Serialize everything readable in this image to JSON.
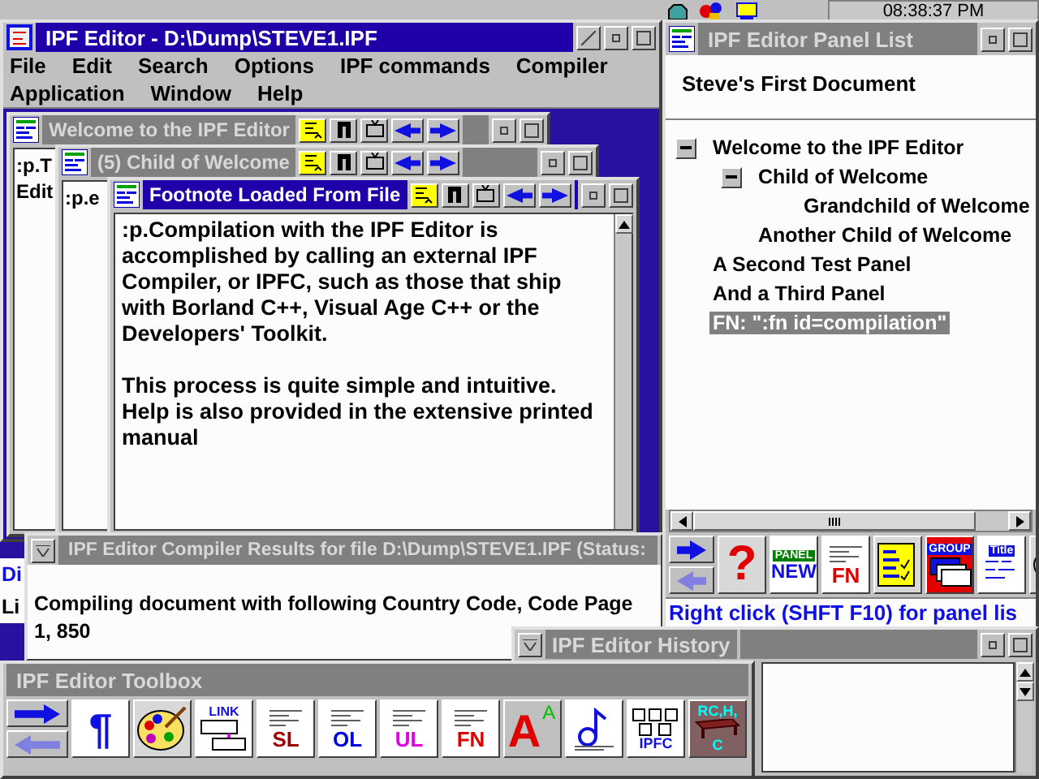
{
  "taskbar": {
    "clock": "08:38:37 PM"
  },
  "main_window": {
    "title": "IPF Editor - D:\\Dump\\STEVE1.IPF",
    "active": true,
    "menu": [
      [
        "File",
        "Edit",
        "Search",
        "Options",
        "IPF commands",
        "Compiler"
      ],
      [
        "Application",
        "Window",
        "Help"
      ]
    ],
    "documents": [
      {
        "title": "Welcome to the IPF Editor",
        "active": false,
        "paragraphs": [
          ":p.T",
          "Edit"
        ]
      },
      {
        "title": "(5) Child of Welcome",
        "active": false,
        "paragraphs": [
          ":p.e"
        ]
      },
      {
        "title": "Footnote Loaded From File",
        "active": true,
        "paragraphs": [
          ":p.Compilation with the IPF Editor is accomplished by calling an external IPF Compiler, or IPFC, such as those that ship with Borland C++, Visual Age C++ or the Developers' Toolkit.",
          "This process is quite simple and intuitive. Help is also provided in the extensive printed manual"
        ]
      }
    ]
  },
  "behind_window": {
    "lines": [
      "Di",
      "Li"
    ]
  },
  "panel_list": {
    "title": "IPF Editor Panel List",
    "active": false,
    "document": "Steve's First Document",
    "tree": [
      {
        "label": "Welcome to the IPF Editor",
        "expanded": true,
        "selected": false,
        "children": [
          {
            "label": "Child of Welcome",
            "expanded": true,
            "selected": false,
            "children": [
              {
                "label": "Grandchild of Welcome",
                "selected": false
              }
            ]
          },
          {
            "label": "Another Child of Welcome",
            "selected": false
          }
        ]
      },
      {
        "label": "A Second Test Panel",
        "selected": false
      },
      {
        "label": "And a Third Panel",
        "selected": false
      },
      {
        "label": "FN: \":fn id=compilation\"",
        "selected": true
      }
    ],
    "tools": [
      {
        "kind": "nav"
      },
      {
        "kind": "help",
        "label": "?"
      },
      {
        "kind": "new",
        "caption": "PANEL",
        "label": "NEW"
      },
      {
        "kind": "doc",
        "label": "FN",
        "color": "#e00000"
      },
      {
        "kind": "checklist"
      },
      {
        "kind": "group",
        "caption": "GROUP"
      },
      {
        "kind": "title",
        "caption": "Title"
      },
      {
        "kind": "partial"
      }
    ],
    "status": "Right click (SHFT F10) for panel lis"
  },
  "compiler_results": {
    "title": "IPF Editor Compiler Results for file D:\\Dump\\STEVE1.IPF (Status:",
    "active": false,
    "lines": [
      "Compiling document with following Country Code, Code Page",
      "1, 850"
    ]
  },
  "history": {
    "title": "IPF Editor History",
    "active": false
  },
  "toolbox": {
    "title": "IPF Editor Toolbox",
    "active": false,
    "tools": [
      {
        "kind": "nav"
      },
      {
        "kind": "paragraph",
        "label": "¶"
      },
      {
        "kind": "palette"
      },
      {
        "kind": "link",
        "caption": "LINK"
      },
      {
        "kind": "doc",
        "label": "SL",
        "color": "#a00000"
      },
      {
        "kind": "doc",
        "label": "OL",
        "color": "#0000e0"
      },
      {
        "kind": "doc",
        "label": "UL",
        "color": "#e000e0"
      },
      {
        "kind": "doc",
        "label": "FN",
        "color": "#e00000"
      },
      {
        "kind": "font",
        "label": "A",
        "caption": "A"
      },
      {
        "kind": "note"
      },
      {
        "kind": "ipfc",
        "label": "IPFC"
      },
      {
        "kind": "table",
        "caption": "RC,H,",
        "label": "C"
      }
    ]
  }
}
